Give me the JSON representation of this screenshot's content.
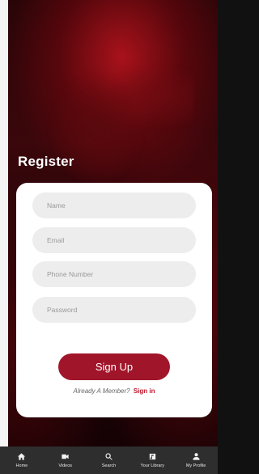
{
  "header": {
    "title": "Register"
  },
  "form": {
    "name_placeholder": "Name",
    "email_placeholder": "Email",
    "phone_placeholder": "Phone Number",
    "password_placeholder": "Password",
    "signup_label": "Sign Up",
    "already_member_text": "Already A Member?",
    "signin_link": "Sign in"
  },
  "nav": {
    "items": [
      {
        "label": "Home",
        "icon": "home-icon"
      },
      {
        "label": "Videos",
        "icon": "video-camera-icon"
      },
      {
        "label": "Search",
        "icon": "search-icon"
      },
      {
        "label": "Your Library",
        "icon": "library-icon"
      },
      {
        "label": "My Profile",
        "icon": "profile-icon"
      }
    ]
  },
  "colors": {
    "accent": "#a1152a",
    "link": "#c3132a",
    "nav_bg": "#2e2e2e",
    "field_bg": "#ededed"
  }
}
